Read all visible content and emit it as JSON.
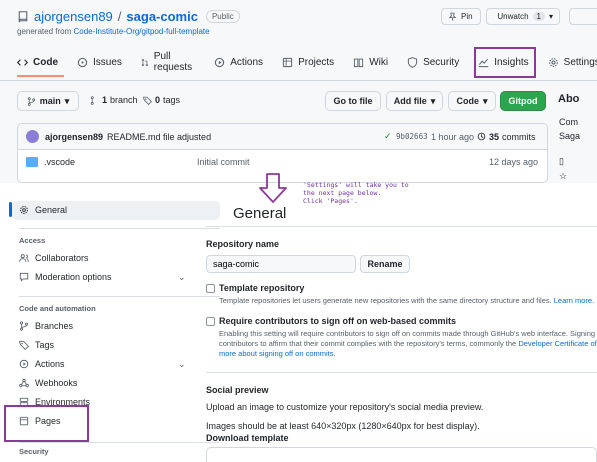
{
  "repo": {
    "owner": "ajorgensen89",
    "separator": "/",
    "name": "saga-comic",
    "visibility": "Public",
    "generated_prefix": "generated from",
    "generated_from": "Code-Institute-Org/gitpod-full-template"
  },
  "header_buttons": {
    "pin": "Pin",
    "unwatch": "Unwatch",
    "unwatch_count": "1"
  },
  "tabs": [
    {
      "label": "Code",
      "icon": "code-icon"
    },
    {
      "label": "Issues",
      "icon": "issue-icon"
    },
    {
      "label": "Pull requests",
      "icon": "pull-request-icon"
    },
    {
      "label": "Actions",
      "icon": "play-icon"
    },
    {
      "label": "Projects",
      "icon": "table-icon"
    },
    {
      "label": "Wiki",
      "icon": "book-icon"
    },
    {
      "label": "Security",
      "icon": "shield-icon"
    },
    {
      "label": "Insights",
      "icon": "graph-icon"
    },
    {
      "label": "Settings",
      "icon": "gear-icon"
    }
  ],
  "toolbar": {
    "branch": "main",
    "branches_count": "1",
    "branches_label": "branch",
    "tags_count": "0",
    "tags_label": "tags",
    "go_to_file": "Go to file",
    "add_file": "Add file",
    "code": "Code",
    "gitpod": "Gitpod"
  },
  "commit": {
    "author": "ajorgensen89",
    "message": "README.md file adjusted",
    "hash": "9b02663",
    "time": "1 hour ago",
    "commits_count": "35",
    "commits_label": "commits"
  },
  "files": [
    {
      "name": ".vscode",
      "message": "Initial commit",
      "time": "12 days ago"
    }
  ],
  "about": {
    "title": "Abo",
    "line1": "Com",
    "line2": "Saga"
  },
  "annotation": "'Settings' will take you to\nthe next page below.\nClick 'Pages'.",
  "sidebar": {
    "general": "General",
    "access_heading": "Access",
    "collaborators": "Collaborators",
    "moderation": "Moderation options",
    "code_heading": "Code and automation",
    "branches": "Branches",
    "tags": "Tags",
    "actions": "Actions",
    "webhooks": "Webhooks",
    "environments": "Environments",
    "pages": "Pages",
    "security_heading": "Security"
  },
  "main": {
    "title": "General",
    "repo_name_label": "Repository name",
    "repo_name_value": "saga-comic",
    "rename": "Rename",
    "template_label": "Template repository",
    "template_desc": "Template repositories let users generate new repositories with the same directory structure and files.",
    "template_link": "Learn more.",
    "signoff_label": "Require contributors to sign off on web-based commits",
    "signoff_desc1": "Enabling this setting will require contributors to sign off on commits made through GitHub's web interface. Signing o",
    "signoff_desc2": "contributors to affirm that their commit complies with the repository's terms, commonly the",
    "signoff_link1": "Developer Certificate of",
    "signoff_link2": "more about signing off on commits.",
    "social_heading": "Social preview",
    "social_desc": "Upload an image to customize your repository's social media preview.",
    "image_hint": "Images should be at least 640×320px (1280×640px for best display).",
    "download": "Download template"
  },
  "colors": {
    "accent": "#0969da",
    "highlight": "#8b3a9a",
    "green": "#2da44e",
    "active_tab": "#fd8c73"
  }
}
